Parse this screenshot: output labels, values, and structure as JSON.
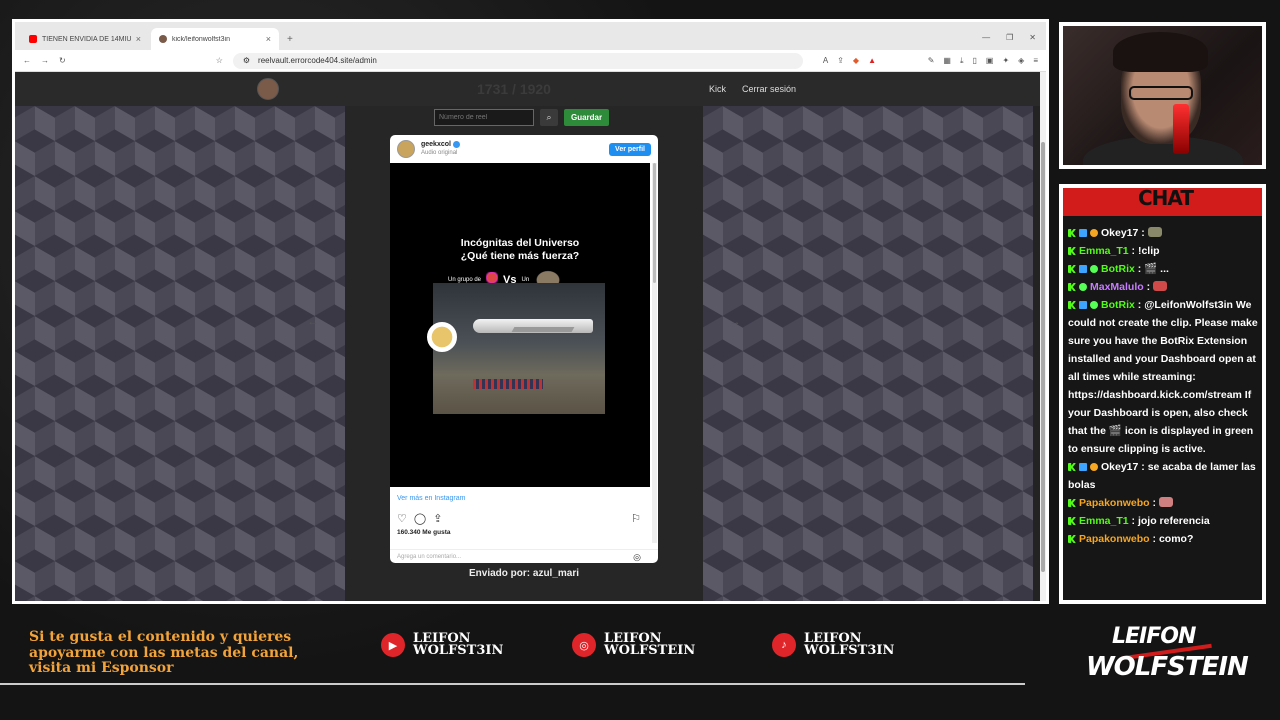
{
  "browser": {
    "tabs": [
      {
        "title": "TIENEN ENVIDIA DE 14MIU - YouTube",
        "favicon_color": "#ff0000",
        "active": false
      },
      {
        "title": "kick/leifonwolfst3in",
        "favicon_color": "#53fc18",
        "active": true
      }
    ],
    "url": "reelvault.errorcode404.site/admin"
  },
  "site": {
    "reel_counter": "1731 / 1920",
    "nav": {
      "kick": "Kick",
      "logout": "Cerrar sesión"
    },
    "reel_input_placeholder": "Número de reel",
    "save_label": "Guardar",
    "sent_by": "Enviado por: azul_mari"
  },
  "instagram": {
    "username": "geekxcol",
    "subtitle": "Audio original",
    "follow_label": "Ver perfil",
    "video_title_line1": "Incógnitas del Universo",
    "video_title_line2": "¿Qué tiene más fuerza?",
    "compare_left": "Un grupo de",
    "compare_vs": "Vs",
    "compare_right": "Un",
    "view_more": "Ver más en Instagram",
    "likes": "160.340 Me gusta",
    "comment_placeholder": "Agrega un comentario..."
  },
  "chat": {
    "title": "CHAT",
    "messages": [
      {
        "badges": [
          "k",
          "b",
          "o"
        ],
        "user": "Okey17",
        "color": "#ffffff",
        "text": "",
        "emote": "#8a8a6a"
      },
      {
        "badges": [
          "k"
        ],
        "user": "Emma_T1",
        "color": "#53fc18",
        "text": "!clip"
      },
      {
        "badges": [
          "k",
          "b",
          "g"
        ],
        "user": "BotRix",
        "color": "#53fc18",
        "text": "🎬 ..."
      },
      {
        "badges": [
          "k",
          "g"
        ],
        "user": "MaxMalulo",
        "color": "#c77dff",
        "text": "",
        "emote": "#d04a4a"
      },
      {
        "badges": [
          "k",
          "b",
          "g"
        ],
        "user": "BotRix",
        "color": "#53fc18",
        "text": "@LeifonWolfst3in We could not create the clip. Please make sure you have the BotRix Extension installed and your Dashboard open at all times while streaming: https://dashboard.kick.com/stream If your Dashboard is open, also check that the 🎬 icon is displayed in green to ensure clipping is active."
      },
      {
        "badges": [
          "k",
          "b",
          "o"
        ],
        "user": "Okey17",
        "color": "#ffffff",
        "text": "se acaba de lamer las bolas"
      },
      {
        "badges": [
          "k"
        ],
        "user": "Papakonwebo",
        "color": "#f5a623",
        "text": "",
        "emote": "#d08080"
      },
      {
        "badges": [
          "k"
        ],
        "user": "Emma_T1",
        "color": "#53fc18",
        "text": "jojo referencia"
      },
      {
        "badges": [
          "k"
        ],
        "user": "Papakonwebo",
        "color": "#f5a623",
        "text": "como?"
      }
    ]
  },
  "overlay": {
    "sponsor_line1": "Si te gusta el contenido y quieres",
    "sponsor_line2": "apoyarme con las metas del canal,",
    "sponsor_line3": "visita mi Esponsor",
    "socials": [
      {
        "icon": "youtube-icon",
        "line1": "LEIFON",
        "line2": "WOLFST3IN"
      },
      {
        "icon": "instagram-icon",
        "line1": "LEIFON",
        "line2": "WOLFSTEIN"
      },
      {
        "icon": "tiktok-icon",
        "line1": "LEIFON",
        "line2": "WOLFST3IN"
      }
    ],
    "logo_line1": "LEIFON",
    "logo_line2": "WOLFSTEIN"
  },
  "colors": {
    "accent_red": "#d21b1b",
    "kick_green": "#53fc18",
    "sponsor_orange": "#f2a33a",
    "save_green": "#2e8b3a"
  }
}
